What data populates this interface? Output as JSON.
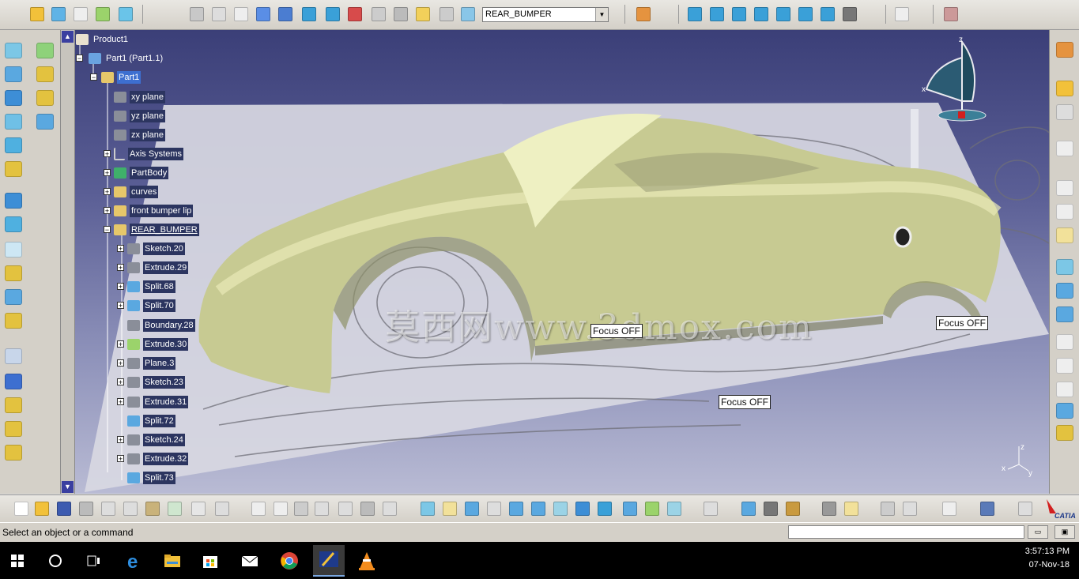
{
  "toolbar": {
    "part_combo_value": "REAR_BUMPER"
  },
  "tree": {
    "nodes": [
      {
        "label": "Product1"
      },
      {
        "label": "Part1 (Part1.1)"
      },
      {
        "label": "Part1"
      },
      {
        "label": "xy plane"
      },
      {
        "label": "yz plane"
      },
      {
        "label": "zx plane"
      },
      {
        "label": "Axis Systems"
      },
      {
        "label": "PartBody"
      },
      {
        "label": "curves"
      },
      {
        "label": "front bumper lip"
      },
      {
        "label": "REAR_BUMPER"
      },
      {
        "label": "Sketch.20"
      },
      {
        "label": "Extrude.29"
      },
      {
        "label": "Split.68"
      },
      {
        "label": "Split.70"
      },
      {
        "label": "Boundary.28"
      },
      {
        "label": "Extrude.30"
      },
      {
        "label": "Plane.3"
      },
      {
        "label": "Sketch.23"
      },
      {
        "label": "Extrude.31"
      },
      {
        "label": "Split.72"
      },
      {
        "label": "Sketch.24"
      },
      {
        "label": "Extrude.32"
      },
      {
        "label": "Split.73"
      }
    ]
  },
  "viewport": {
    "focus_labels": [
      "Focus OFF",
      "Focus OFF",
      "Focus OFF"
    ],
    "watermark": "莫西网www.3dmox.com",
    "compass_x": "x",
    "compass_z": "z",
    "axis_x": "x",
    "axis_y": "y",
    "axis_z": "z"
  },
  "statusbar": {
    "message": "Select an object or a command"
  },
  "catia_logo": "CATIA",
  "taskbar": {
    "time": "3:57:13 PM",
    "date": "07-Nov-18"
  },
  "colors": {
    "viewport_top": "#3b3f78",
    "car_body": "#c9cc96",
    "selection": "#3d6fd0",
    "tree_label_bg": "#2c3560"
  }
}
